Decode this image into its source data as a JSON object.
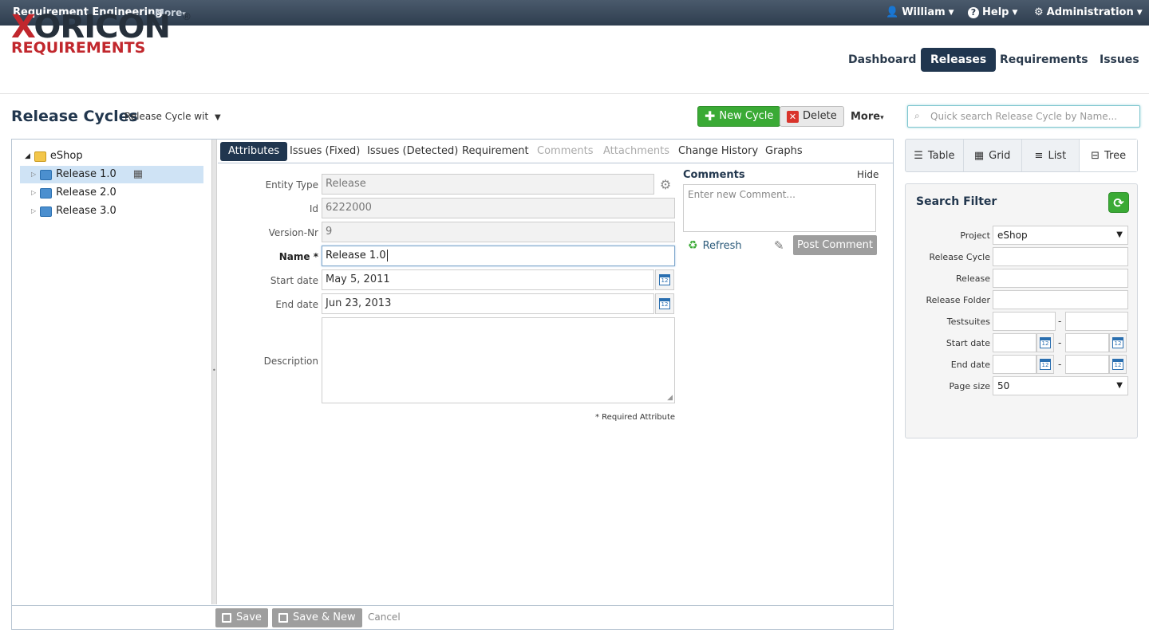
{
  "topbar": {
    "app_name": "Requirement Engineering",
    "more": "More",
    "user": "William",
    "help": "Help",
    "admin": "Administration"
  },
  "logo": {
    "main_x": "X",
    "main_rest": "ORICON",
    "reg": "®",
    "sub": "REQUIREMENTS"
  },
  "nav": {
    "dashboard": "Dashboard",
    "releases": "Releases",
    "requirements": "Requirements",
    "issues": "Issues"
  },
  "page": {
    "title": "Release Cycles",
    "cycle_select": "Release Cycle wit"
  },
  "toolbar": {
    "new_cycle": "New Cycle",
    "delete": "Delete",
    "more": "More"
  },
  "search": {
    "placeholder": "Quick search Release Cycle by Name..."
  },
  "tree": {
    "root": "eShop",
    "items": [
      "Release 1.0",
      "Release 2.0",
      "Release 3.0"
    ]
  },
  "tabs": [
    "Attributes",
    "Issues (Fixed)",
    "Issues (Detected)",
    "Requirement",
    "Comments",
    "Attachments",
    "Change History",
    "Graphs"
  ],
  "form": {
    "entity_type_label": "Entity Type",
    "entity_type": "Release",
    "id_label": "Id",
    "id": "6222000",
    "version_label": "Version-Nr",
    "version": "9",
    "name_label": "Name",
    "name": "Release 1.0",
    "start_label": "Start date",
    "start": "May 5, 2011",
    "end_label": "End date",
    "end": "Jun 23, 2013",
    "desc_label": "Description",
    "required_note": "* Required Attribute",
    "required_star": "*",
    "cal_day": "12"
  },
  "comments": {
    "title": "Comments",
    "hide": "Hide",
    "placeholder": "Enter new Comment...",
    "refresh": "Refresh",
    "post": "Post Comment"
  },
  "bottom": {
    "save": "Save",
    "save_new": "Save & New",
    "cancel": "Cancel"
  },
  "views": {
    "table": "Table",
    "grid": "Grid",
    "list": "List",
    "tree": "Tree"
  },
  "filter": {
    "title": "Search Filter",
    "project_label": "Project",
    "project": "eShop",
    "release_cycle_label": "Release Cycle",
    "release_label": "Release",
    "release_folder_label": "Release Folder",
    "testsuites_label": "Testsuites",
    "start_label": "Start date",
    "end_label": "End date",
    "page_size_label": "Page size",
    "page_size": "50",
    "dash": "-"
  },
  "colors": {
    "accent": "#20364f",
    "green": "#3aaa35",
    "logo_red": "#c1272d"
  }
}
